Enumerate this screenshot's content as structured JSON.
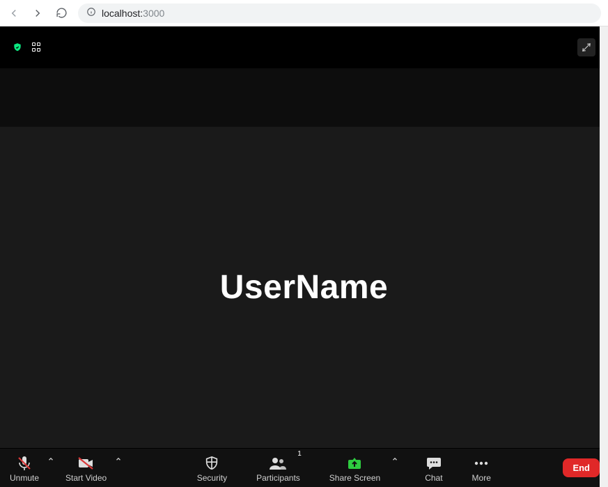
{
  "browser": {
    "url_host": "localhost:",
    "url_port": "3000"
  },
  "main": {
    "display_name": "UserName"
  },
  "toolbar": {
    "unmute_label": "Unmute",
    "start_video_label": "Start Video",
    "security_label": "Security",
    "participants_label": "Participants",
    "participants_count": "1",
    "share_screen_label": "Share Screen",
    "chat_label": "Chat",
    "more_label": "More",
    "end_label": "End"
  }
}
